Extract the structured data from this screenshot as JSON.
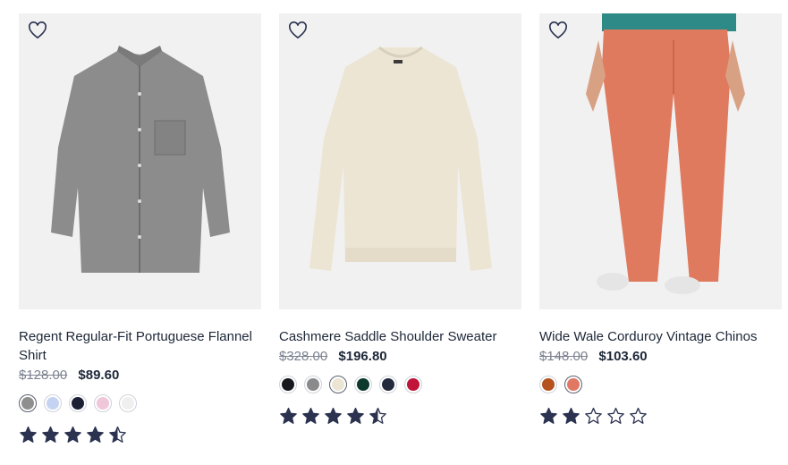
{
  "products": [
    {
      "name": "Regent Regular-Fit Portuguese Flannel Shirt",
      "was_price": "$128.00",
      "price": "$89.60",
      "rating": 4.5,
      "swatches": [
        "#8f8f8f",
        "#c5d3f3",
        "#1b2034",
        "#efc7d9",
        "#efefef"
      ],
      "selected_swatch": 0
    },
    {
      "name": "Cashmere Saddle Shoulder Sweater",
      "was_price": "$328.00",
      "price": "$196.80",
      "rating": 4.5,
      "swatches": [
        "#16181d",
        "#8a8a8a",
        "#ece5d4",
        "#0e3a2e",
        "#232a3e",
        "#c0143a"
      ],
      "selected_swatch": 2
    },
    {
      "name": "Wide Wale Corduroy Vintage Chinos",
      "was_price": "$148.00",
      "price": "$103.60",
      "rating": 2,
      "swatches": [
        "#b4531f",
        "#e07863"
      ],
      "selected_swatch": 1
    }
  ],
  "colors": {
    "text": "#1d2738",
    "strike": "#7c8290",
    "star": "#2b3350",
    "image_bg": "#f1f1f1"
  },
  "icons": {
    "wishlist": "heart-outline-icon",
    "rating": "star-icon"
  }
}
